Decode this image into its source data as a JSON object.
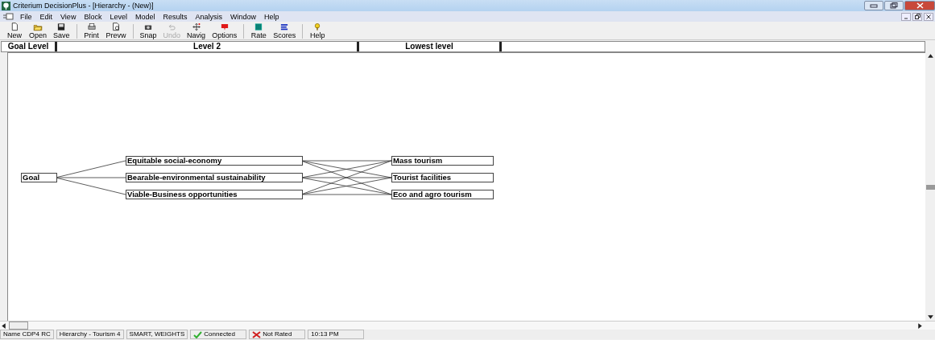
{
  "window": {
    "title": "Criterium DecisionPlus - [Hierarchy - (New)]"
  },
  "menu": [
    "File",
    "Edit",
    "View",
    "Block",
    "Level",
    "Model",
    "Results",
    "Analysis",
    "Window",
    "Help"
  ],
  "toolbar": [
    {
      "label": "New",
      "disabled": false
    },
    {
      "label": "Open",
      "disabled": false
    },
    {
      "label": "Save",
      "disabled": false
    },
    {
      "label": "Print",
      "disabled": false
    },
    {
      "label": "Prevw",
      "disabled": false
    },
    {
      "label": "Snap",
      "disabled": false
    },
    {
      "label": "Undo",
      "disabled": true
    },
    {
      "label": "Navig",
      "disabled": false
    },
    {
      "label": "Options",
      "disabled": false
    },
    {
      "label": "Rate",
      "disabled": false
    },
    {
      "label": "Scores",
      "disabled": false
    },
    {
      "label": "Help",
      "disabled": false
    }
  ],
  "levels": [
    "Goal Level",
    "Level 2",
    "Lowest level"
  ],
  "hierarchy": {
    "goal": "Goal",
    "criteria": [
      "Equitable social-economy",
      "Bearable-environmental sustainability",
      "Viable-Business opportunities"
    ],
    "alternatives": [
      "Mass tourism",
      "Tourist facilities",
      "Eco and agro tourism"
    ]
  },
  "status_bar": {
    "name": "Name CDP4 RC",
    "model": "Hierarchy - Tourism 4",
    "method": "SMART, WEIGHTS",
    "connection": "Connected",
    "connected": true,
    "rating": "Not Rated",
    "rated": false,
    "time": "10:13 PM"
  }
}
